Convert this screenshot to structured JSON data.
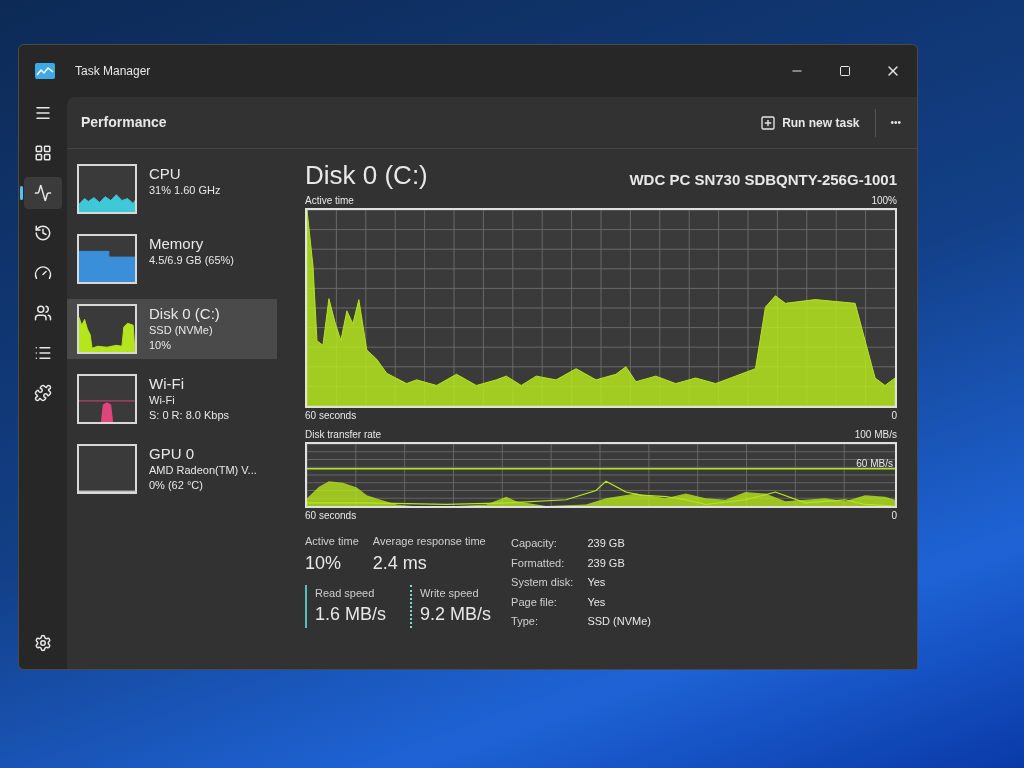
{
  "window": {
    "title": "Task Manager"
  },
  "nav": [
    {
      "kind": "menu",
      "selected": false
    },
    {
      "kind": "processes",
      "selected": false
    },
    {
      "kind": "performance",
      "selected": true
    },
    {
      "kind": "history",
      "selected": false
    },
    {
      "kind": "startup",
      "selected": false
    },
    {
      "kind": "users",
      "selected": false
    },
    {
      "kind": "details",
      "selected": false
    },
    {
      "kind": "services",
      "selected": false
    }
  ],
  "page": {
    "title": "Performance",
    "run_new_task": "Run new task",
    "more": "•••"
  },
  "devices": [
    {
      "kind": "cpu",
      "name": "CPU",
      "lines": [
        "31%  1.60 GHz"
      ],
      "color": "#3ec8d8",
      "selected": false
    },
    {
      "kind": "memory",
      "name": "Memory",
      "lines": [
        "4.5/6.9 GB (65%)"
      ],
      "color": "#3a8fd8",
      "selected": false
    },
    {
      "kind": "disk",
      "name": "Disk 0 (C:)",
      "lines": [
        "SSD (NVMe)",
        "10%"
      ],
      "color": "#b5e61d",
      "selected": true
    },
    {
      "kind": "wifi",
      "name": "Wi-Fi",
      "lines": [
        "Wi-Fi",
        "S: 0 R: 8.0 Kbps"
      ],
      "color": "#e0457b",
      "selected": false
    },
    {
      "kind": "gpu",
      "name": "GPU 0",
      "lines": [
        "AMD Radeon(TM) V...",
        "0%  (62 °C)"
      ],
      "color": "#c0c0c0",
      "selected": false
    }
  ],
  "detail": {
    "title": "Disk 0 (C:)",
    "model": "WDC PC SN730 SDBQNTY-256G-1001",
    "active_chart": {
      "label": "Active time",
      "max": "100%",
      "span": "60 seconds",
      "min": "0"
    },
    "transfer_chart": {
      "label": "Disk transfer rate",
      "max": "100 MB/s",
      "mid": "60 MB/s",
      "span": "60 seconds",
      "min": "0"
    },
    "stats": [
      {
        "label": "Active time",
        "value": "10%"
      },
      {
        "label": "Average response time",
        "value": "2.4 ms"
      }
    ],
    "speeds": [
      {
        "kind": "read",
        "label": "Read speed",
        "value": "1.6 MB/s"
      },
      {
        "kind": "write",
        "label": "Write speed",
        "value": "9.2 MB/s"
      }
    ],
    "properties": [
      {
        "label": "Capacity:",
        "value": "239 GB"
      },
      {
        "label": "Formatted:",
        "value": "239 GB"
      },
      {
        "label": "System disk:",
        "value": "Yes"
      },
      {
        "label": "Page file:",
        "value": "Yes"
      },
      {
        "label": "Type:",
        "value": "SSD (NVMe)"
      }
    ]
  }
}
